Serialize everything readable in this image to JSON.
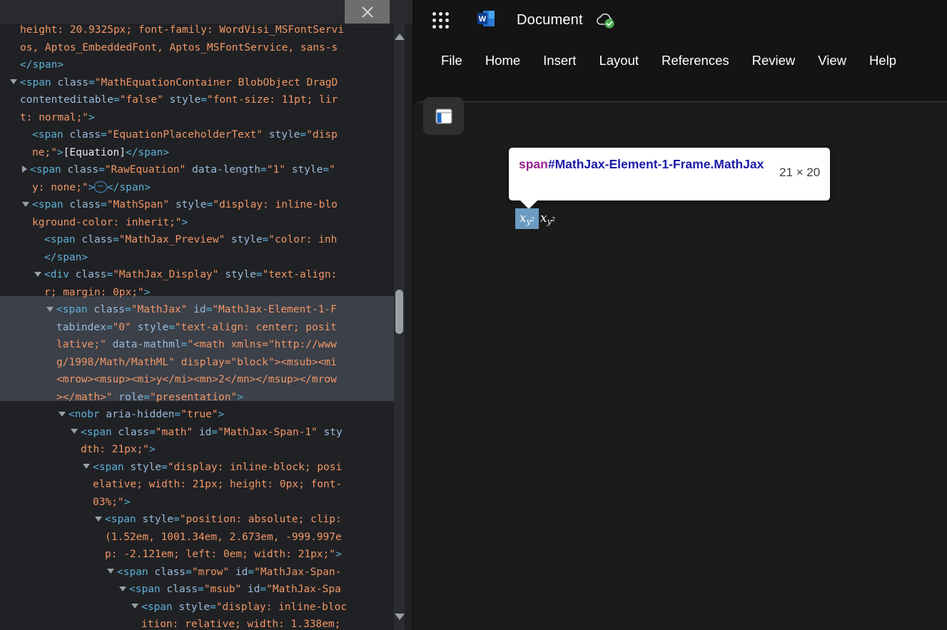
{
  "devtools": {
    "close_label": "close-icon",
    "scrollbar": {
      "up": "scroll-up-arrow",
      "down": "scroll-down-arrow"
    },
    "lines": [
      {
        "indent": 0,
        "clipped": true,
        "parts": [
          {
            "t": "val",
            "s": "height: 20.9325px; font-family: WordVisi_MSFontServi"
          }
        ]
      },
      {
        "indent": 0,
        "parts": [
          {
            "t": "val",
            "s": "os, Aptos_EmbeddedFont, Aptos_MSFontService, sans-s"
          }
        ]
      },
      {
        "indent": 0,
        "parts": [
          {
            "t": "tag",
            "s": "</span>"
          }
        ]
      },
      {
        "indent": 0,
        "tri": "down",
        "parts": [
          {
            "t": "punc",
            "s": "<"
          },
          {
            "t": "tag",
            "s": "span"
          },
          {
            "t": "attr",
            "s": " class"
          },
          {
            "t": "punc",
            "s": "="
          },
          {
            "t": "val",
            "s": "\"MathEquationContainer BlobObject DragD"
          }
        ]
      },
      {
        "indent": 0,
        "parts": [
          {
            "t": "attr",
            "s": "contenteditable"
          },
          {
            "t": "punc",
            "s": "="
          },
          {
            "t": "val",
            "s": "\"false\""
          },
          {
            "t": "attr",
            "s": " style"
          },
          {
            "t": "punc",
            "s": "="
          },
          {
            "t": "val",
            "s": "\"font-size: 11pt; lir"
          }
        ]
      },
      {
        "indent": 0,
        "parts": [
          {
            "t": "val",
            "s": "t: normal;\""
          },
          {
            "t": "punc",
            "s": ">"
          }
        ]
      },
      {
        "indent": 1,
        "parts": [
          {
            "t": "punc",
            "s": "<"
          },
          {
            "t": "tag",
            "s": "span"
          },
          {
            "t": "attr",
            "s": " class"
          },
          {
            "t": "punc",
            "s": "="
          },
          {
            "t": "val",
            "s": "\"EquationPlaceholderText\""
          },
          {
            "t": "attr",
            "s": " style"
          },
          {
            "t": "punc",
            "s": "="
          },
          {
            "t": "val",
            "s": "\"disp"
          }
        ]
      },
      {
        "indent": 1,
        "parts": [
          {
            "t": "val",
            "s": "ne;\""
          },
          {
            "t": "punc",
            "s": ">"
          },
          {
            "t": "txt",
            "s": "[Equation]"
          },
          {
            "t": "tag",
            "s": "</span>"
          }
        ]
      },
      {
        "indent": 1,
        "tri": "right",
        "parts": [
          {
            "t": "punc",
            "s": "<"
          },
          {
            "t": "tag",
            "s": "span"
          },
          {
            "t": "attr",
            "s": " class"
          },
          {
            "t": "punc",
            "s": "="
          },
          {
            "t": "val",
            "s": "\"RawEquation\""
          },
          {
            "t": "attr",
            "s": " data-length"
          },
          {
            "t": "punc",
            "s": "="
          },
          {
            "t": "val",
            "s": "\"1\""
          },
          {
            "t": "attr",
            "s": " style"
          },
          {
            "t": "punc",
            "s": "="
          },
          {
            "t": "val",
            "s": "\""
          }
        ]
      },
      {
        "indent": 1,
        "badge": true,
        "parts": [
          {
            "t": "val",
            "s": "y: none;\""
          },
          {
            "t": "punc",
            "s": ">"
          }
        ],
        "after": [
          {
            "t": "tag",
            "s": "</span>"
          }
        ]
      },
      {
        "indent": 1,
        "tri": "down",
        "parts": [
          {
            "t": "punc",
            "s": "<"
          },
          {
            "t": "tag",
            "s": "span"
          },
          {
            "t": "attr",
            "s": " class"
          },
          {
            "t": "punc",
            "s": "="
          },
          {
            "t": "val",
            "s": "\"MathSpan\""
          },
          {
            "t": "attr",
            "s": " style"
          },
          {
            "t": "punc",
            "s": "="
          },
          {
            "t": "val",
            "s": "\"display: inline-blo"
          }
        ]
      },
      {
        "indent": 1,
        "parts": [
          {
            "t": "val",
            "s": "kground-color: inherit;\""
          },
          {
            "t": "punc",
            "s": ">"
          }
        ]
      },
      {
        "indent": 2,
        "parts": [
          {
            "t": "punc",
            "s": "<"
          },
          {
            "t": "tag",
            "s": "span"
          },
          {
            "t": "attr",
            "s": " class"
          },
          {
            "t": "punc",
            "s": "="
          },
          {
            "t": "val",
            "s": "\"MathJax_Preview\""
          },
          {
            "t": "attr",
            "s": " style"
          },
          {
            "t": "punc",
            "s": "="
          },
          {
            "t": "val",
            "s": "\"color: inh"
          }
        ]
      },
      {
        "indent": 2,
        "parts": [
          {
            "t": "tag",
            "s": "</span>"
          }
        ]
      },
      {
        "indent": 2,
        "tri": "down",
        "parts": [
          {
            "t": "punc",
            "s": "<"
          },
          {
            "t": "tag",
            "s": "div"
          },
          {
            "t": "attr",
            "s": " class"
          },
          {
            "t": "punc",
            "s": "="
          },
          {
            "t": "val",
            "s": "\"MathJax_Display\""
          },
          {
            "t": "attr",
            "s": " style"
          },
          {
            "t": "punc",
            "s": "="
          },
          {
            "t": "val",
            "s": "\"text-align:"
          }
        ]
      },
      {
        "indent": 2,
        "parts": [
          {
            "t": "val",
            "s": "r; margin: 0px;\""
          },
          {
            "t": "punc",
            "s": ">"
          }
        ]
      },
      {
        "indent": 3,
        "sel": true,
        "tri": "down",
        "parts": [
          {
            "t": "punc",
            "s": "<"
          },
          {
            "t": "tag",
            "s": "span"
          },
          {
            "t": "attr",
            "s": " class"
          },
          {
            "t": "punc",
            "s": "="
          },
          {
            "t": "val",
            "s": "\"MathJax\""
          },
          {
            "t": "attr",
            "s": " id"
          },
          {
            "t": "punc",
            "s": "="
          },
          {
            "t": "val",
            "s": "\"MathJax-Element-1-F"
          }
        ]
      },
      {
        "indent": 3,
        "sel": true,
        "parts": [
          {
            "t": "attr",
            "s": "tabindex"
          },
          {
            "t": "punc",
            "s": "="
          },
          {
            "t": "val",
            "s": "\"0\""
          },
          {
            "t": "attr",
            "s": " style"
          },
          {
            "t": "punc",
            "s": "="
          },
          {
            "t": "val",
            "s": "\"text-align: center; posit"
          }
        ]
      },
      {
        "indent": 3,
        "sel": true,
        "parts": [
          {
            "t": "val",
            "s": "lative;\""
          },
          {
            "t": "attr",
            "s": " data-mathml"
          },
          {
            "t": "punc",
            "s": "="
          },
          {
            "t": "val",
            "s": "\"<math xmlns=\"http://www"
          }
        ]
      },
      {
        "indent": 3,
        "sel": true,
        "parts": [
          {
            "t": "val",
            "s": "g/1998/Math/MathML\" display=\"block\"><msub><mi"
          }
        ]
      },
      {
        "indent": 3,
        "sel": true,
        "parts": [
          {
            "t": "val",
            "s": "<mrow><msup><mi>y</mi><mn>2</mn></msup></mrow"
          }
        ]
      },
      {
        "indent": 3,
        "sel": true,
        "parts": [
          {
            "t": "val",
            "s": "></math>\""
          },
          {
            "t": "attr",
            "s": " role"
          },
          {
            "t": "punc",
            "s": "="
          },
          {
            "t": "val",
            "s": "\"presentation\""
          },
          {
            "t": "punc",
            "s": ">"
          }
        ]
      },
      {
        "indent": 4,
        "tri": "down",
        "parts": [
          {
            "t": "punc",
            "s": "<"
          },
          {
            "t": "tag",
            "s": "nobr"
          },
          {
            "t": "attr",
            "s": " aria-hidden"
          },
          {
            "t": "punc",
            "s": "="
          },
          {
            "t": "val",
            "s": "\"true\""
          },
          {
            "t": "punc",
            "s": ">"
          }
        ]
      },
      {
        "indent": 5,
        "tri": "down",
        "parts": [
          {
            "t": "punc",
            "s": "<"
          },
          {
            "t": "tag",
            "s": "span"
          },
          {
            "t": "attr",
            "s": " class"
          },
          {
            "t": "punc",
            "s": "="
          },
          {
            "t": "val",
            "s": "\"math\""
          },
          {
            "t": "attr",
            "s": " id"
          },
          {
            "t": "punc",
            "s": "="
          },
          {
            "t": "val",
            "s": "\"MathJax-Span-1\""
          },
          {
            "t": "attr",
            "s": " sty"
          }
        ]
      },
      {
        "indent": 5,
        "parts": [
          {
            "t": "val",
            "s": "dth: 21px;\""
          },
          {
            "t": "punc",
            "s": ">"
          }
        ]
      },
      {
        "indent": 6,
        "tri": "down",
        "parts": [
          {
            "t": "punc",
            "s": "<"
          },
          {
            "t": "tag",
            "s": "span"
          },
          {
            "t": "attr",
            "s": " style"
          },
          {
            "t": "punc",
            "s": "="
          },
          {
            "t": "val",
            "s": "\"display: inline-block; posi"
          }
        ]
      },
      {
        "indent": 6,
        "parts": [
          {
            "t": "val",
            "s": "elative; width: 21px; height: 0px; font-"
          }
        ]
      },
      {
        "indent": 6,
        "parts": [
          {
            "t": "val",
            "s": "03%;\""
          },
          {
            "t": "punc",
            "s": ">"
          }
        ]
      },
      {
        "indent": 7,
        "tri": "down",
        "parts": [
          {
            "t": "punc",
            "s": "<"
          },
          {
            "t": "tag",
            "s": "span"
          },
          {
            "t": "attr",
            "s": " style"
          },
          {
            "t": "punc",
            "s": "="
          },
          {
            "t": "val",
            "s": "\"position: absolute; clip:"
          }
        ]
      },
      {
        "indent": 7,
        "parts": [
          {
            "t": "val",
            "s": "(1.52em, 1001.34em, 2.673em, -999.997e"
          }
        ]
      },
      {
        "indent": 7,
        "parts": [
          {
            "t": "val",
            "s": "p: -2.121em; left: 0em; width: 21px;\""
          },
          {
            "t": "punc",
            "s": ">"
          }
        ]
      },
      {
        "indent": 8,
        "tri": "down",
        "parts": [
          {
            "t": "punc",
            "s": "<"
          },
          {
            "t": "tag",
            "s": "span"
          },
          {
            "t": "attr",
            "s": " class"
          },
          {
            "t": "punc",
            "s": "="
          },
          {
            "t": "val",
            "s": "\"mrow\""
          },
          {
            "t": "attr",
            "s": " id"
          },
          {
            "t": "punc",
            "s": "="
          },
          {
            "t": "val",
            "s": "\"MathJax-Span-"
          }
        ]
      },
      {
        "indent": 9,
        "tri": "down",
        "parts": [
          {
            "t": "punc",
            "s": "<"
          },
          {
            "t": "tag",
            "s": "span"
          },
          {
            "t": "attr",
            "s": " class"
          },
          {
            "t": "punc",
            "s": "="
          },
          {
            "t": "val",
            "s": "\"msub\""
          },
          {
            "t": "attr",
            "s": " id"
          },
          {
            "t": "punc",
            "s": "="
          },
          {
            "t": "val",
            "s": "\"MathJax-Spa"
          }
        ]
      },
      {
        "indent": 10,
        "tri": "down",
        "parts": [
          {
            "t": "punc",
            "s": "<"
          },
          {
            "t": "tag",
            "s": "span"
          },
          {
            "t": "attr",
            "s": " style"
          },
          {
            "t": "punc",
            "s": "="
          },
          {
            "t": "val",
            "s": "\"display: inline-bloc"
          }
        ]
      },
      {
        "indent": 10,
        "parts": [
          {
            "t": "val",
            "s": "ition: relative; width: 1.338em;"
          }
        ]
      }
    ]
  },
  "word": {
    "waffle_icon": "app-launcher-icon",
    "logo_icon": "word-logo-icon",
    "doc_title": "Document",
    "cloud_icon": "cloud-saved-icon",
    "tabs": [
      {
        "label": "File"
      },
      {
        "label": "Home"
      },
      {
        "label": "Insert"
      },
      {
        "label": "Layout"
      },
      {
        "label": "References"
      },
      {
        "label": "Review"
      },
      {
        "label": "View"
      },
      {
        "label": "Help"
      }
    ],
    "nav_pane_icon": "navigation-pane-icon"
  },
  "inspector": {
    "selector_tag": "span",
    "selector_rest": "#MathJax-Element-1-Frame.MathJax",
    "dimensions": "21 × 20"
  },
  "math": {
    "base": "x",
    "sub": "y",
    "sup": "2"
  },
  "colors": {
    "accent_blue": "#2b7cd3",
    "highlight_row": "#3b4049",
    "selection_blue": "#6b9bc3",
    "tag": "#5db0d7",
    "attr_value": "#f29766",
    "cloud_green": "#4caf50"
  }
}
